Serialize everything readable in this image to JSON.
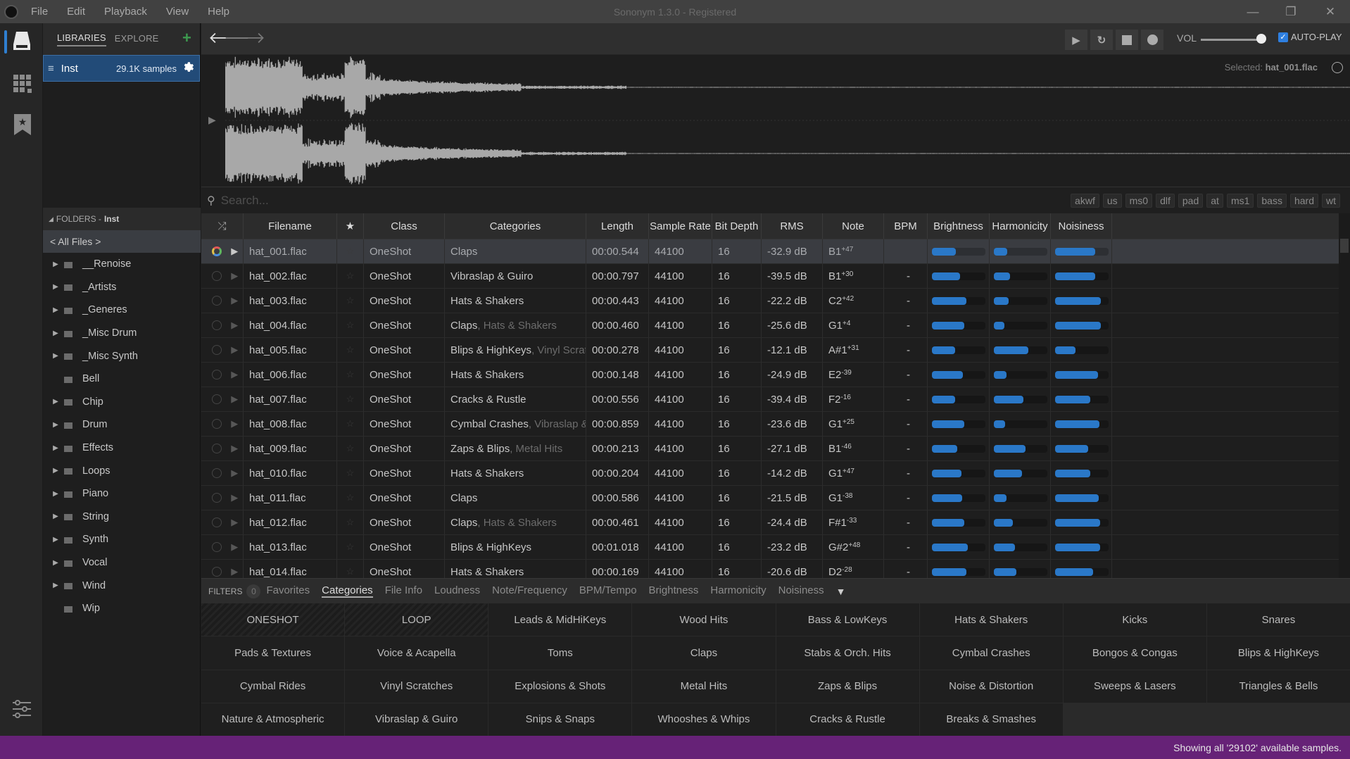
{
  "app": {
    "title": "Sononym 1.3.0 - Registered",
    "menu": [
      "File",
      "Edit",
      "Playback",
      "View",
      "Help"
    ]
  },
  "rail": {
    "items": [
      "library-drive",
      "grid-view",
      "favorites-bookmark"
    ],
    "bottom": "settings-sliders"
  },
  "library": {
    "tabs": [
      {
        "label": "LIBRARIES",
        "active": true
      },
      {
        "label": "EXPLORE",
        "active": false
      }
    ],
    "item": {
      "name": "Inst",
      "count": "29.1K samples"
    },
    "folders_header": "FOLDERS - ",
    "folders_lib": "Inst",
    "all_files": "< All Files >",
    "folders": [
      {
        "name": "__Renoise",
        "expandable": true
      },
      {
        "name": "_Artists",
        "expandable": true
      },
      {
        "name": "_Generes",
        "expandable": true
      },
      {
        "name": "_Misc Drum",
        "expandable": true
      },
      {
        "name": "_Misc Synth",
        "expandable": true
      },
      {
        "name": "Bell",
        "expandable": false
      },
      {
        "name": "Chip",
        "expandable": true
      },
      {
        "name": "Drum",
        "expandable": true
      },
      {
        "name": "Effects",
        "expandable": true
      },
      {
        "name": "Loops",
        "expandable": true
      },
      {
        "name": "Piano",
        "expandable": true
      },
      {
        "name": "String",
        "expandable": true
      },
      {
        "name": "Synth",
        "expandable": true
      },
      {
        "name": "Vocal",
        "expandable": true
      },
      {
        "name": "Wind",
        "expandable": true
      },
      {
        "name": "Wip",
        "expandable": false
      }
    ]
  },
  "toolbar": {
    "vol_label": "VOL",
    "volume": 0.95,
    "autoplay_label": "AUTO-PLAY",
    "autoplay_checked": true
  },
  "waveform": {
    "selected_label": "Selected: ",
    "selected_file": "hat_001.flac"
  },
  "search": {
    "placeholder": "Search...",
    "tags": [
      "akwf",
      "us",
      "ms0",
      "dlf",
      "pad",
      "at",
      "ms1",
      "bass",
      "hard",
      "wt"
    ]
  },
  "table": {
    "columns": [
      "Filename",
      "★",
      "Class",
      "Categories",
      "Length",
      "Sample Rate",
      "Bit Depth",
      "RMS",
      "Note",
      "BPM",
      "Brightness",
      "Harmonicity",
      "Noisiness"
    ],
    "rows": [
      {
        "file": "hat_001.flac",
        "class": "OneShot",
        "cat1": "Claps",
        "cat2": "",
        "length": "00:00.544",
        "sr": "44100",
        "bd": "16",
        "rms": "-32.9 dB",
        "note": "B1",
        "cents": "+47",
        "bpm": "",
        "bright": 0.45,
        "harm": 0.25,
        "noise": 0.75
      },
      {
        "file": "hat_002.flac",
        "class": "OneShot",
        "cat1": "Vibraslap & Guiro",
        "cat2": "",
        "length": "00:00.797",
        "sr": "44100",
        "bd": "16",
        "rms": "-39.5 dB",
        "note": "B1",
        "cents": "+30",
        "bpm": "-",
        "bright": 0.52,
        "harm": 0.3,
        "noise": 0.75
      },
      {
        "file": "hat_003.flac",
        "class": "OneShot",
        "cat1": "Hats & Shakers",
        "cat2": "",
        "length": "00:00.443",
        "sr": "44100",
        "bd": "16",
        "rms": "-22.2 dB",
        "note": "C2",
        "cents": "+42",
        "bpm": "-",
        "bright": 0.65,
        "harm": 0.27,
        "noise": 0.85
      },
      {
        "file": "hat_004.flac",
        "class": "OneShot",
        "cat1": "Claps",
        "cat2": ", Hats & Shakers",
        "length": "00:00.460",
        "sr": "44100",
        "bd": "16",
        "rms": "-25.6 dB",
        "note": "G1",
        "cents": "+4",
        "bpm": "-",
        "bright": 0.61,
        "harm": 0.2,
        "noise": 0.85
      },
      {
        "file": "hat_005.flac",
        "class": "OneShot",
        "cat1": "Blips & HighKeys",
        "cat2": ", Vinyl Scratc",
        "length": "00:00.278",
        "sr": "44100",
        "bd": "16",
        "rms": "-12.1 dB",
        "note": "A#1",
        "cents": "+31",
        "bpm": "-",
        "bright": 0.44,
        "harm": 0.65,
        "noise": 0.38
      },
      {
        "file": "hat_006.flac",
        "class": "OneShot",
        "cat1": "Hats & Shakers",
        "cat2": "",
        "length": "00:00.148",
        "sr": "44100",
        "bd": "16",
        "rms": "-24.9 dB",
        "note": "E2",
        "cents": "-39",
        "bpm": "-",
        "bright": 0.58,
        "harm": 0.24,
        "noise": 0.8
      },
      {
        "file": "hat_007.flac",
        "class": "OneShot",
        "cat1": "Cracks & Rustle",
        "cat2": "",
        "length": "00:00.556",
        "sr": "44100",
        "bd": "16",
        "rms": "-39.4 dB",
        "note": "F2",
        "cents": "-16",
        "bpm": "-",
        "bright": 0.44,
        "harm": 0.55,
        "noise": 0.66
      },
      {
        "file": "hat_008.flac",
        "class": "OneShot",
        "cat1": "Cymbal Crashes",
        "cat2": ", Vibraslap & G",
        "length": "00:00.859",
        "sr": "44100",
        "bd": "16",
        "rms": "-23.6 dB",
        "note": "G1",
        "cents": "+25",
        "bpm": "-",
        "bright": 0.61,
        "harm": 0.21,
        "noise": 0.83
      },
      {
        "file": "hat_009.flac",
        "class": "OneShot",
        "cat1": "Zaps & Blips",
        "cat2": ", Metal Hits",
        "length": "00:00.213",
        "sr": "44100",
        "bd": "16",
        "rms": "-27.1 dB",
        "note": "B1",
        "cents": "-46",
        "bpm": "-",
        "bright": 0.48,
        "harm": 0.59,
        "noise": 0.62
      },
      {
        "file": "hat_010.flac",
        "class": "OneShot",
        "cat1": "Hats & Shakers",
        "cat2": "",
        "length": "00:00.204",
        "sr": "44100",
        "bd": "16",
        "rms": "-14.2 dB",
        "note": "G1",
        "cents": "+47",
        "bpm": "-",
        "bright": 0.55,
        "harm": 0.52,
        "noise": 0.66
      },
      {
        "file": "hat_011.flac",
        "class": "OneShot",
        "cat1": "Claps",
        "cat2": "",
        "length": "00:00.586",
        "sr": "44100",
        "bd": "16",
        "rms": "-21.5 dB",
        "note": "G1",
        "cents": "-38",
        "bpm": "-",
        "bright": 0.57,
        "harm": 0.24,
        "noise": 0.82
      },
      {
        "file": "hat_012.flac",
        "class": "OneShot",
        "cat1": "Claps",
        "cat2": ", Hats & Shakers",
        "length": "00:00.461",
        "sr": "44100",
        "bd": "16",
        "rms": "-24.4 dB",
        "note": "F#1",
        "cents": "-33",
        "bpm": "-",
        "bright": 0.61,
        "harm": 0.36,
        "noise": 0.84
      },
      {
        "file": "hat_013.flac",
        "class": "OneShot",
        "cat1": "Blips & HighKeys",
        "cat2": "",
        "length": "00:01.018",
        "sr": "44100",
        "bd": "16",
        "rms": "-23.2 dB",
        "note": "G#2",
        "cents": "+48",
        "bpm": "-",
        "bright": 0.67,
        "harm": 0.4,
        "noise": 0.84
      },
      {
        "file": "hat_014.flac",
        "class": "OneShot",
        "cat1": "Hats & Shakers",
        "cat2": "",
        "length": "00:00.169",
        "sr": "44100",
        "bd": "16",
        "rms": "-20.6 dB",
        "note": "D2",
        "cents": "-28",
        "bpm": "-",
        "bright": 0.64,
        "harm": 0.42,
        "noise": 0.71
      }
    ]
  },
  "filters": {
    "label": "FILTERS",
    "count": "0",
    "tabs": [
      {
        "label": "Favorites",
        "active": false
      },
      {
        "label": "Categories",
        "active": true
      },
      {
        "label": "File Info",
        "active": false
      },
      {
        "label": "Loudness",
        "active": false
      },
      {
        "label": "Note/Frequency",
        "active": false
      },
      {
        "label": "BPM/Tempo",
        "active": false
      },
      {
        "label": "Brightness",
        "active": false
      },
      {
        "label": "Harmonicity",
        "active": false
      },
      {
        "label": "Noisiness",
        "active": false
      }
    ],
    "categories": [
      "ONESHOT",
      "LOOP",
      "Leads & MidHiKeys",
      "Wood Hits",
      "Bass & LowKeys",
      "Hats & Shakers",
      "Kicks",
      "Snares",
      "Pads & Textures",
      "Voice & Acapella",
      "Toms",
      "Claps",
      "Stabs & Orch. Hits",
      "Cymbal Crashes",
      "Bongos & Congas",
      "Blips & HighKeys",
      "Cymbal Rides",
      "Vinyl Scratches",
      "Explosions & Shots",
      "Metal Hits",
      "Zaps & Blips",
      "Noise & Distortion",
      "Sweeps & Lasers",
      "Triangles & Bells",
      "Nature & Atmospheric",
      "Vibraslap & Guiro",
      "Snips & Snaps",
      "Whooshes & Whips",
      "Cracks & Rustle",
      "Breaks & Smashes"
    ]
  },
  "status": {
    "text": "Showing all '29102' available samples."
  },
  "colors": {
    "accent": "#2a78c8",
    "footer": "#662277",
    "selection": "#224b78"
  }
}
